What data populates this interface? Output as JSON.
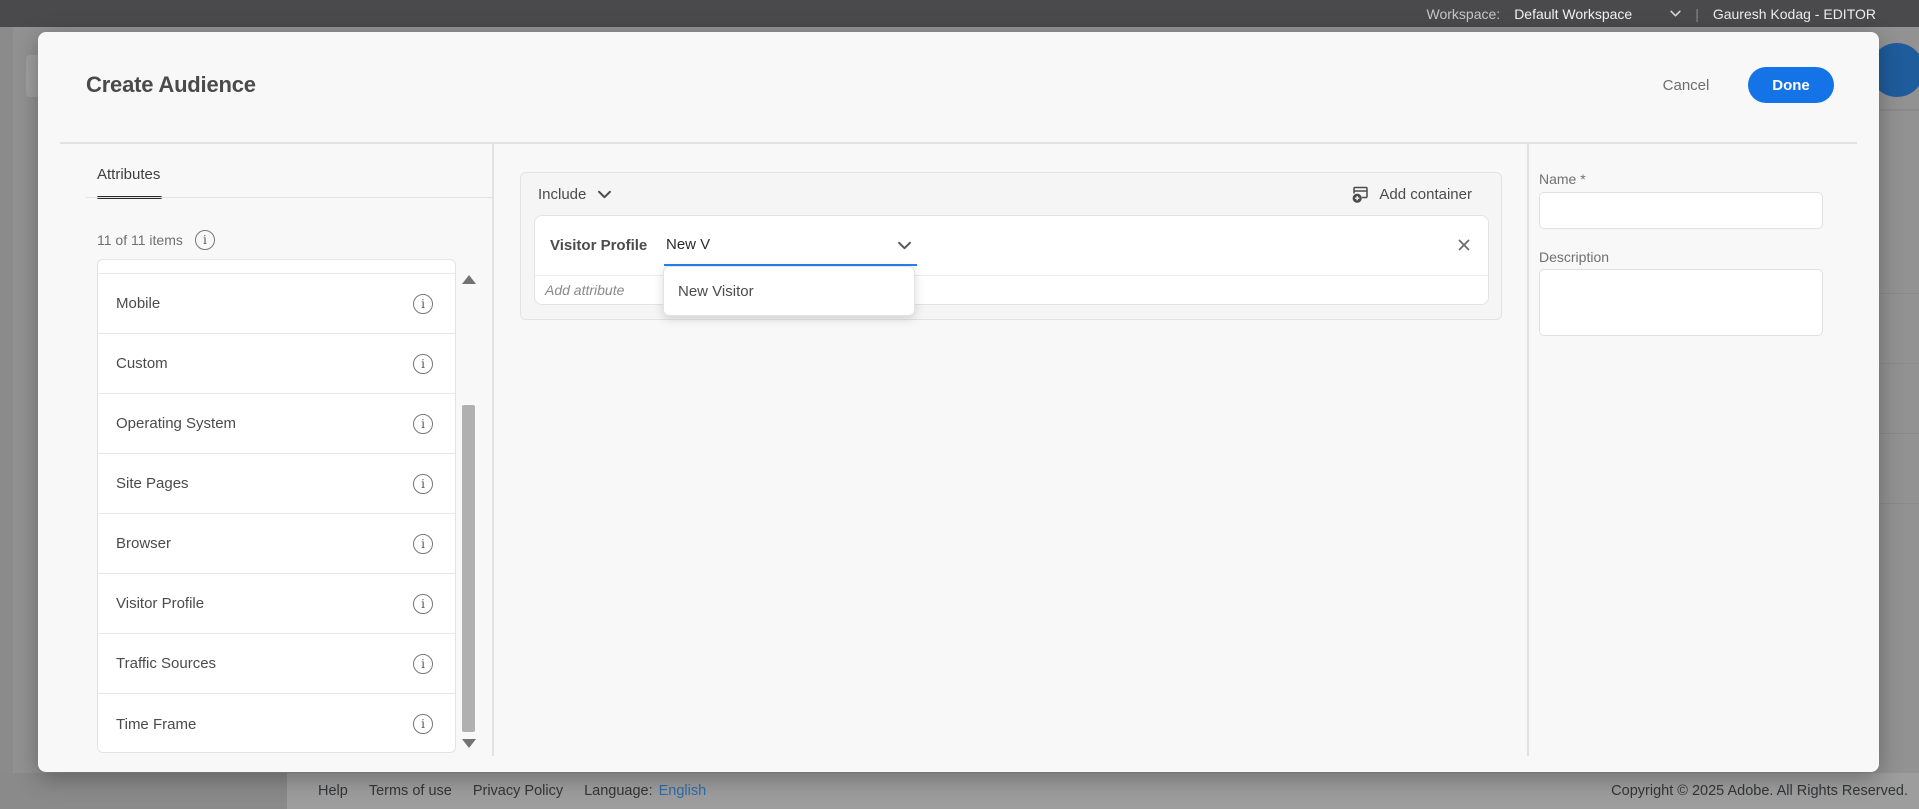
{
  "colors": {
    "accent": "#1473E6",
    "focus_underline": "#2680EB",
    "fab": "#1E5C9C"
  },
  "topbar": {
    "workspace_label": "Workspace:",
    "workspace_value": "Default Workspace",
    "user": "Gauresh Kodag - EDITOR"
  },
  "modal": {
    "title": "Create Audience",
    "cancel_label": "Cancel",
    "done_label": "Done",
    "sidebar": {
      "tab_label": "Attributes",
      "count_text": "11 of 11 items",
      "items": [
        {
          "label": "Mobile"
        },
        {
          "label": "Custom"
        },
        {
          "label": "Operating System"
        },
        {
          "label": "Site Pages"
        },
        {
          "label": "Browser"
        },
        {
          "label": "Visitor Profile"
        },
        {
          "label": "Traffic Sources"
        },
        {
          "label": "Time Frame"
        }
      ]
    },
    "builder": {
      "include_label": "Include",
      "add_container_label": "Add container",
      "attribute_label": "Visitor Profile",
      "combobox_value": "New V",
      "options": [
        {
          "label": "New Visitor"
        }
      ],
      "add_attribute_label": "Add attribute"
    },
    "details": {
      "name_label": "Name *",
      "description_label": "Description"
    }
  },
  "footer": {
    "help": "Help",
    "terms": "Terms of use",
    "privacy": "Privacy Policy",
    "language_label": "Language:",
    "language_value": "English",
    "copyright": "Copyright © 2025 Adobe. All Rights Reserved."
  }
}
